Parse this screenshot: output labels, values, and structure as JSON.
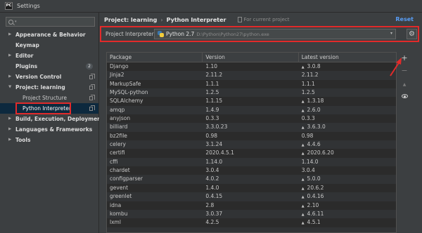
{
  "window": {
    "title": "Settings",
    "app_icon": "PC"
  },
  "sidebar": {
    "search_caret": "▾",
    "items": [
      {
        "label": "Appearance & Behavior",
        "arrow": "▶"
      },
      {
        "label": "Keymap",
        "arrow": ""
      },
      {
        "label": "Editor",
        "arrow": "▶"
      },
      {
        "label": "Plugins",
        "arrow": "",
        "badge": "2"
      },
      {
        "label": "Version Control",
        "arrow": "▶"
      },
      {
        "label": "Project: learning",
        "arrow": "▼"
      },
      {
        "label": "Project Structure"
      },
      {
        "label": "Python Interpreter"
      },
      {
        "label": "Build, Execution, Deployment",
        "arrow": "▶"
      },
      {
        "label": "Languages & Frameworks",
        "arrow": "▶"
      },
      {
        "label": "Tools",
        "arrow": "▶"
      }
    ]
  },
  "header": {
    "crumb_project": "Project: learning",
    "crumb_sep": "›",
    "crumb_page": "Python Interpreter",
    "scope": "For current project",
    "reset": "Reset"
  },
  "interpreter": {
    "label": "Project Interpreter:",
    "name": "Python 2.7",
    "path": "D:\\Python\\Python27\\python.exe",
    "caret": "▾",
    "gear": "⚙"
  },
  "table": {
    "headers": [
      "Package",
      "Version",
      "Latest version"
    ],
    "rows": [
      [
        "Django",
        "1.10",
        "3.0.8",
        true
      ],
      [
        "Jinja2",
        "2.11.2",
        "2.11.2",
        false
      ],
      [
        "MarkupSafe",
        "1.1.1",
        "1.1.1",
        false
      ],
      [
        "MySQL-python",
        "1.2.5",
        "1.2.5",
        false
      ],
      [
        "SQLAlchemy",
        "1.1.15",
        "1.3.18",
        true
      ],
      [
        "amqp",
        "1.4.9",
        "2.6.0",
        true
      ],
      [
        "anyjson",
        "0.3.3",
        "0.3.3",
        false
      ],
      [
        "billiard",
        "3.3.0.23",
        "3.6.3.0",
        true
      ],
      [
        "bz2file",
        "0.98",
        "0.98",
        false
      ],
      [
        "celery",
        "3.1.24",
        "4.4.6",
        true
      ],
      [
        "certifi",
        "2020.4.5.1",
        "2020.6.20",
        true
      ],
      [
        "cffi",
        "1.14.0",
        "1.14.0",
        false
      ],
      [
        "chardet",
        "3.0.4",
        "3.0.4",
        false
      ],
      [
        "configparser",
        "4.0.2",
        "5.0.0",
        true
      ],
      [
        "gevent",
        "1.4.0",
        "20.6.2",
        true
      ],
      [
        "greenlet",
        "0.4.15",
        "0.4.16",
        true
      ],
      [
        "idna",
        "2.8",
        "2.10",
        true
      ],
      [
        "kombu",
        "3.0.37",
        "4.6.11",
        true
      ],
      [
        "lxml",
        "4.2.5",
        "4.5.1",
        true
      ],
      [
        "…",
        "",
        "",
        false
      ]
    ],
    "upgrade_glyph": "▲"
  },
  "toolbar": {
    "add": "+",
    "remove": "−"
  },
  "colors": {
    "highlight": "#e22a2a",
    "link": "#589df6",
    "selection": "#0d293e"
  }
}
